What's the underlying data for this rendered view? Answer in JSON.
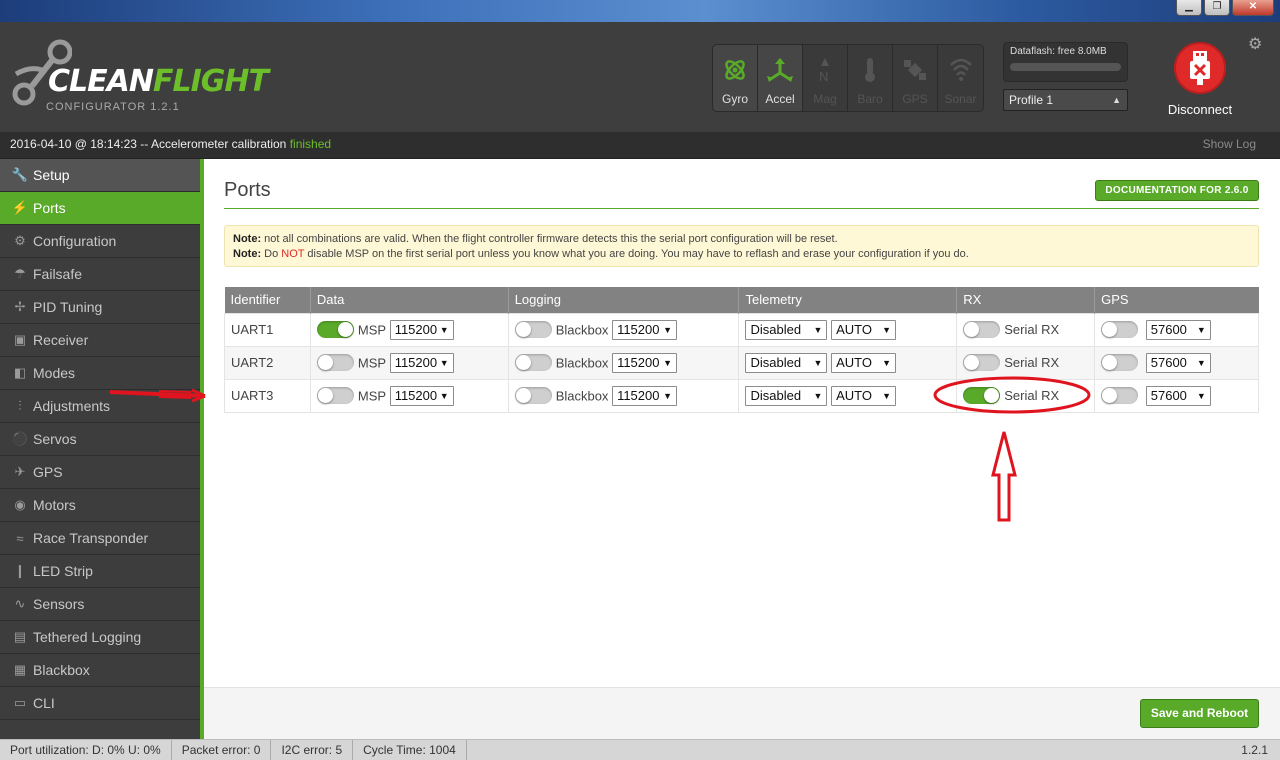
{
  "window": {
    "min_label": "▁",
    "max_label": "❐",
    "close_label": "✕"
  },
  "app": {
    "sub": "CONFIGURATOR  1.2.1"
  },
  "sensors": [
    {
      "label": "Gyro",
      "active": true
    },
    {
      "label": "Accel",
      "active": true
    },
    {
      "label": "Mag",
      "active": false
    },
    {
      "label": "Baro",
      "active": false
    },
    {
      "label": "GPS",
      "active": false
    },
    {
      "label": "Sonar",
      "active": false
    }
  ],
  "dataflash": {
    "label": "Dataflash: free 8.0MB"
  },
  "profile": {
    "selected": "Profile 1"
  },
  "disconnect": {
    "label": "Disconnect"
  },
  "log": {
    "timestamp": "2016-04-10 @ 18:14:23",
    "message": " -- Accelerometer calibration ",
    "status": "finished",
    "show_log": "Show Log"
  },
  "nav": [
    {
      "label": "Setup",
      "icon": "wrench-icon"
    },
    {
      "label": "Ports",
      "icon": "plug-icon"
    },
    {
      "label": "Configuration",
      "icon": "gear-icon"
    },
    {
      "label": "Failsafe",
      "icon": "parachute-icon"
    },
    {
      "label": "PID Tuning",
      "icon": "propeller-icon"
    },
    {
      "label": "Receiver",
      "icon": "receiver-icon"
    },
    {
      "label": "Modes",
      "icon": "toggles-icon"
    },
    {
      "label": "Adjustments",
      "icon": "sliders-icon"
    },
    {
      "label": "Servos",
      "icon": "servo-icon"
    },
    {
      "label": "GPS",
      "icon": "satellite-icon"
    },
    {
      "label": "Motors",
      "icon": "motor-icon"
    },
    {
      "label": "Race Transponder",
      "icon": "transponder-icon"
    },
    {
      "label": "LED Strip",
      "icon": "led-icon"
    },
    {
      "label": "Sensors",
      "icon": "pulse-icon"
    },
    {
      "label": "Tethered Logging",
      "icon": "chart-icon"
    },
    {
      "label": "Blackbox",
      "icon": "blackbox-icon"
    },
    {
      "label": "CLI",
      "icon": "terminal-icon"
    }
  ],
  "page": {
    "title": "Ports",
    "doc_button": "DOCUMENTATION FOR 2.6.0",
    "note": {
      "label1": "Note:",
      "text1": " not all combinations are valid. When the flight controller firmware detects this the serial port configuration will be reset.",
      "label2": "Note:",
      "text2a": " Do ",
      "text2b": "NOT",
      "text2c": " disable MSP on the first serial port unless you know what you are doing. You may have to reflash and erase your configuration if you do."
    },
    "columns": [
      "Identifier",
      "Data",
      "Logging",
      "Telemetry",
      "RX",
      "GPS"
    ],
    "rows": [
      {
        "id": "UART1",
        "msp_on": true,
        "msp_label": "MSP",
        "msp_baud": "115200",
        "bb_on": false,
        "bb_label": "Blackbox",
        "bb_baud": "115200",
        "tel": "Disabled",
        "tel_baud": "AUTO",
        "rx_on": false,
        "rx_label": "Serial RX",
        "gps_on": false,
        "gps_baud": "57600"
      },
      {
        "id": "UART2",
        "msp_on": false,
        "msp_label": "MSP",
        "msp_baud": "115200",
        "bb_on": false,
        "bb_label": "Blackbox",
        "bb_baud": "115200",
        "tel": "Disabled",
        "tel_baud": "AUTO",
        "rx_on": false,
        "rx_label": "Serial RX",
        "gps_on": false,
        "gps_baud": "57600"
      },
      {
        "id": "UART3",
        "msp_on": false,
        "msp_label": "MSP",
        "msp_baud": "115200",
        "bb_on": false,
        "bb_label": "Blackbox",
        "bb_baud": "115200",
        "tel": "Disabled",
        "tel_baud": "AUTO",
        "rx_on": true,
        "rx_label": "Serial RX",
        "gps_on": false,
        "gps_baud": "57600"
      }
    ],
    "save_button": "Save and Reboot"
  },
  "status": {
    "port_util": "Port utilization: D: 0% U: 0%",
    "packet_error": "Packet error: 0",
    "i2c_error": "I2C error: 5",
    "cycle_time": "Cycle Time: 1004",
    "version": "1.2.1"
  },
  "colors": {
    "accent": "#59aa29",
    "header": "#3e3e3e",
    "sidebar": "#3d3d3d",
    "disconnect": "#e02a2a",
    "annotation": "#e0141e"
  }
}
